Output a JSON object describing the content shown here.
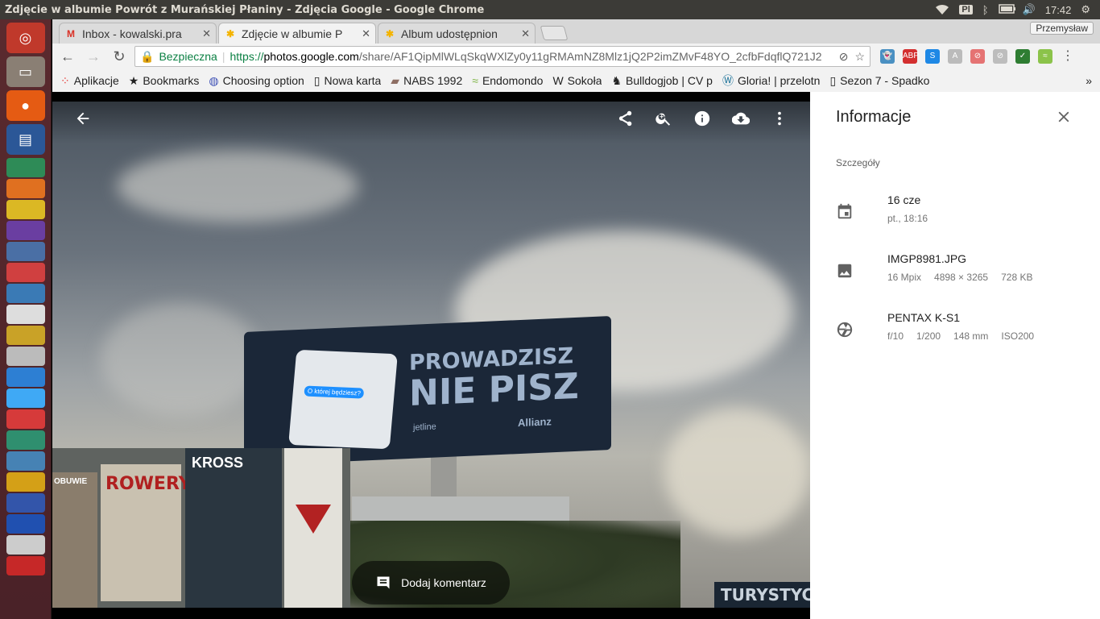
{
  "window": {
    "title": "Zdjęcie w albumie Powrót z Murańskiej Płaniny - Zdjęcia Google - Google Chrome",
    "keyboard": "Pl",
    "clock": "17:42",
    "user": "Przemysław"
  },
  "tabs": [
    {
      "label": "Inbox - kowalski.pra",
      "icon": "gmail-icon"
    },
    {
      "label": "Zdjęcie w albumie P",
      "icon": "google-photos-icon"
    },
    {
      "label": "Album udostępnion",
      "icon": "google-photos-icon"
    }
  ],
  "omnibox": {
    "secure_label": "Bezpieczna",
    "url_scheme": "https://",
    "url_host": "photos.google.com",
    "url_path": "/share/AF1QipMlWLqSkqWXlZy0y11gRMAmNZ8Mlz1jQ2P2imZMvF48YO_2cfbFdqflQ721J2"
  },
  "bookmarks": [
    {
      "label": "Aplikacje",
      "icon": "apps-grid-icon"
    },
    {
      "label": "Bookmarks",
      "icon": "star-icon"
    },
    {
      "label": "Choosing option",
      "icon": "globe-icon"
    },
    {
      "label": "Nowa karta",
      "icon": "page-icon"
    },
    {
      "label": "NABS 1992",
      "icon": "nabs-icon"
    },
    {
      "label": "Endomondo",
      "icon": "endomondo-icon"
    },
    {
      "label": "Sokoła",
      "icon": "wikipedia-icon"
    },
    {
      "label": "Bulldogjob | CV p",
      "icon": "bulldog-icon"
    },
    {
      "label": "Gloria! | przelotn",
      "icon": "wordpress-icon"
    },
    {
      "label": "Sezon 7 - Spadko",
      "icon": "page-icon"
    }
  ],
  "extensions_badges": {
    "ghostery": "0",
    "adblock": "1"
  },
  "viewer": {
    "comment_label": "Dodaj komentarz"
  },
  "photo_content": {
    "billboard_line1": "PROWADZISZ",
    "billboard_line2": "NIE PISZ",
    "billboard_brand": "Allianz",
    "billboard_sponsor": "jetline",
    "phone_bubble": "O której będziesz?",
    "sign_rowery": "ROWERY",
    "sign_kross": "KROSS",
    "sign_obuwie": "OBUWIE",
    "sign_turysty": "TURYSTYC"
  },
  "info": {
    "title": "Informacje",
    "section": "Szczegóły",
    "date_main": "16 cze",
    "date_sub": "pt., 18:16",
    "file_name": "IMGP8981.JPG",
    "file_mpix": "16 Mpix",
    "file_dims": "4898 × 3265",
    "file_size": "728 KB",
    "camera": "PENTAX K-S1",
    "aperture": "f/10",
    "shutter": "1/200",
    "focal": "148 mm",
    "iso": "ISO200"
  }
}
